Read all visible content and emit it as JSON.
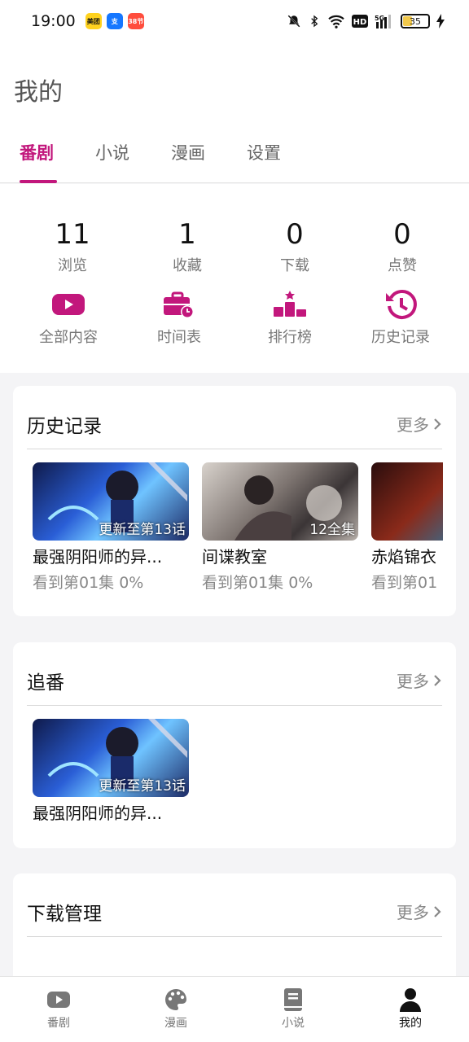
{
  "status": {
    "time": "19:00",
    "battery": "35",
    "apps": [
      "美团",
      "支",
      "38节"
    ]
  },
  "header": {
    "title": "我的"
  },
  "tabs": [
    {
      "label": "番剧",
      "active": true
    },
    {
      "label": "小说"
    },
    {
      "label": "漫画"
    },
    {
      "label": "设置"
    }
  ],
  "stats": [
    {
      "value": "11",
      "label": "浏览"
    },
    {
      "value": "1",
      "label": "收藏"
    },
    {
      "value": "0",
      "label": "下载"
    },
    {
      "value": "0",
      "label": "点赞"
    }
  ],
  "quick_links": [
    {
      "label": "全部内容",
      "icon": "play-icon"
    },
    {
      "label": "时间表",
      "icon": "briefcase-clock-icon"
    },
    {
      "label": "排行榜",
      "icon": "podium-icon"
    },
    {
      "label": "历史记录",
      "icon": "history-icon"
    }
  ],
  "history": {
    "title": "历史记录",
    "more": "更多",
    "items": [
      {
        "title": "最强阴阳师的异...",
        "badge": "更新至第13话",
        "progress": "看到第01集 0%"
      },
      {
        "title": "间谍教室",
        "badge": "12全集",
        "progress": "看到第01集 0%"
      },
      {
        "title": "赤焰锦衣",
        "badge": "",
        "progress": "看到第01"
      }
    ]
  },
  "following": {
    "title": "追番",
    "more": "更多",
    "items": [
      {
        "title": "最强阴阳师的异...",
        "badge": "更新至第13话"
      }
    ]
  },
  "downloads": {
    "title": "下载管理",
    "more": "更多"
  },
  "bottom_nav": [
    {
      "label": "番剧",
      "icon": "play-icon"
    },
    {
      "label": "漫画",
      "icon": "palette-icon"
    },
    {
      "label": "小说",
      "icon": "book-icon"
    },
    {
      "label": "我的",
      "icon": "person-icon",
      "active": true
    }
  ],
  "colors": {
    "accent": "#c2177c"
  }
}
